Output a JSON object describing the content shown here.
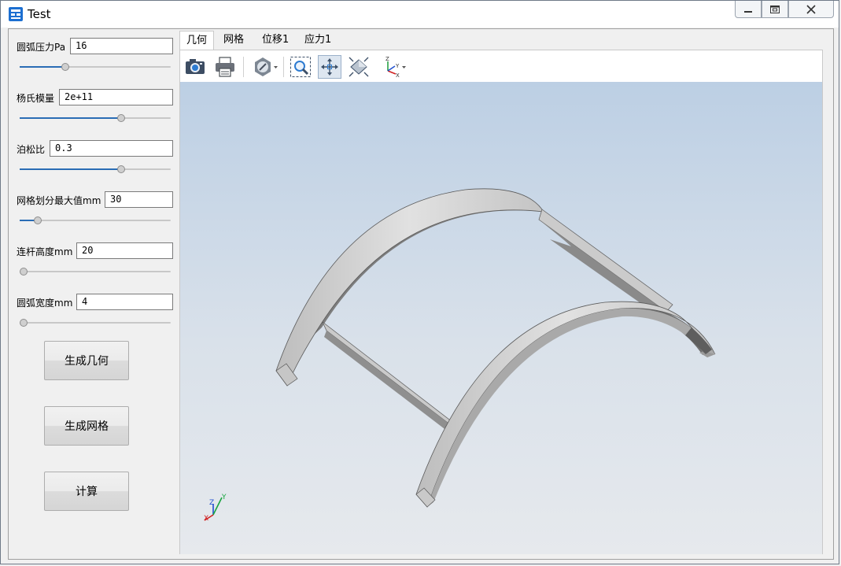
{
  "window": {
    "title": "Test",
    "app_icon": "app-grid-icon",
    "controls": [
      "minimize-icon",
      "maximize-icon",
      "close-icon"
    ]
  },
  "params": [
    {
      "label": "圆弧压力Pa",
      "value": "16",
      "slider_fraction": 0.29
    },
    {
      "label": "杨氏模量",
      "value": "2e+11",
      "slider_fraction": 0.68
    },
    {
      "label": "泊松比",
      "value": "0.3",
      "slider_fraction": 0.68
    },
    {
      "label": "网格划分最大值mm",
      "value": "30",
      "slider_fraction": 0.1
    },
    {
      "label": "连杆高度mm",
      "value": "20",
      "slider_fraction": 0.0
    },
    {
      "label": "圆弧宽度mm",
      "value": "4",
      "slider_fraction": 0.0
    }
  ],
  "buttons": {
    "generate_geometry": "生成几何",
    "generate_mesh": "生成网格",
    "compute": "计算"
  },
  "tabs": [
    "几何",
    "网格",
    "位移1",
    "应力1"
  ],
  "active_tab": "几何",
  "toolbar_icons": [
    "camera-icon",
    "print-icon",
    "display-mode-icon",
    "zoom-window-icon",
    "pan-icon",
    "fit-all-icon",
    "axis-orientation-icon"
  ],
  "axis_triad": {
    "x": "X",
    "y": "Y",
    "z": "Z"
  },
  "colors": {
    "accent": "#2a6db5",
    "viewport_top": "#bccfe4",
    "viewport_bottom": "#e6e9ed",
    "model_face": "#9d9d9d",
    "model_top": "#d8d8d8"
  }
}
